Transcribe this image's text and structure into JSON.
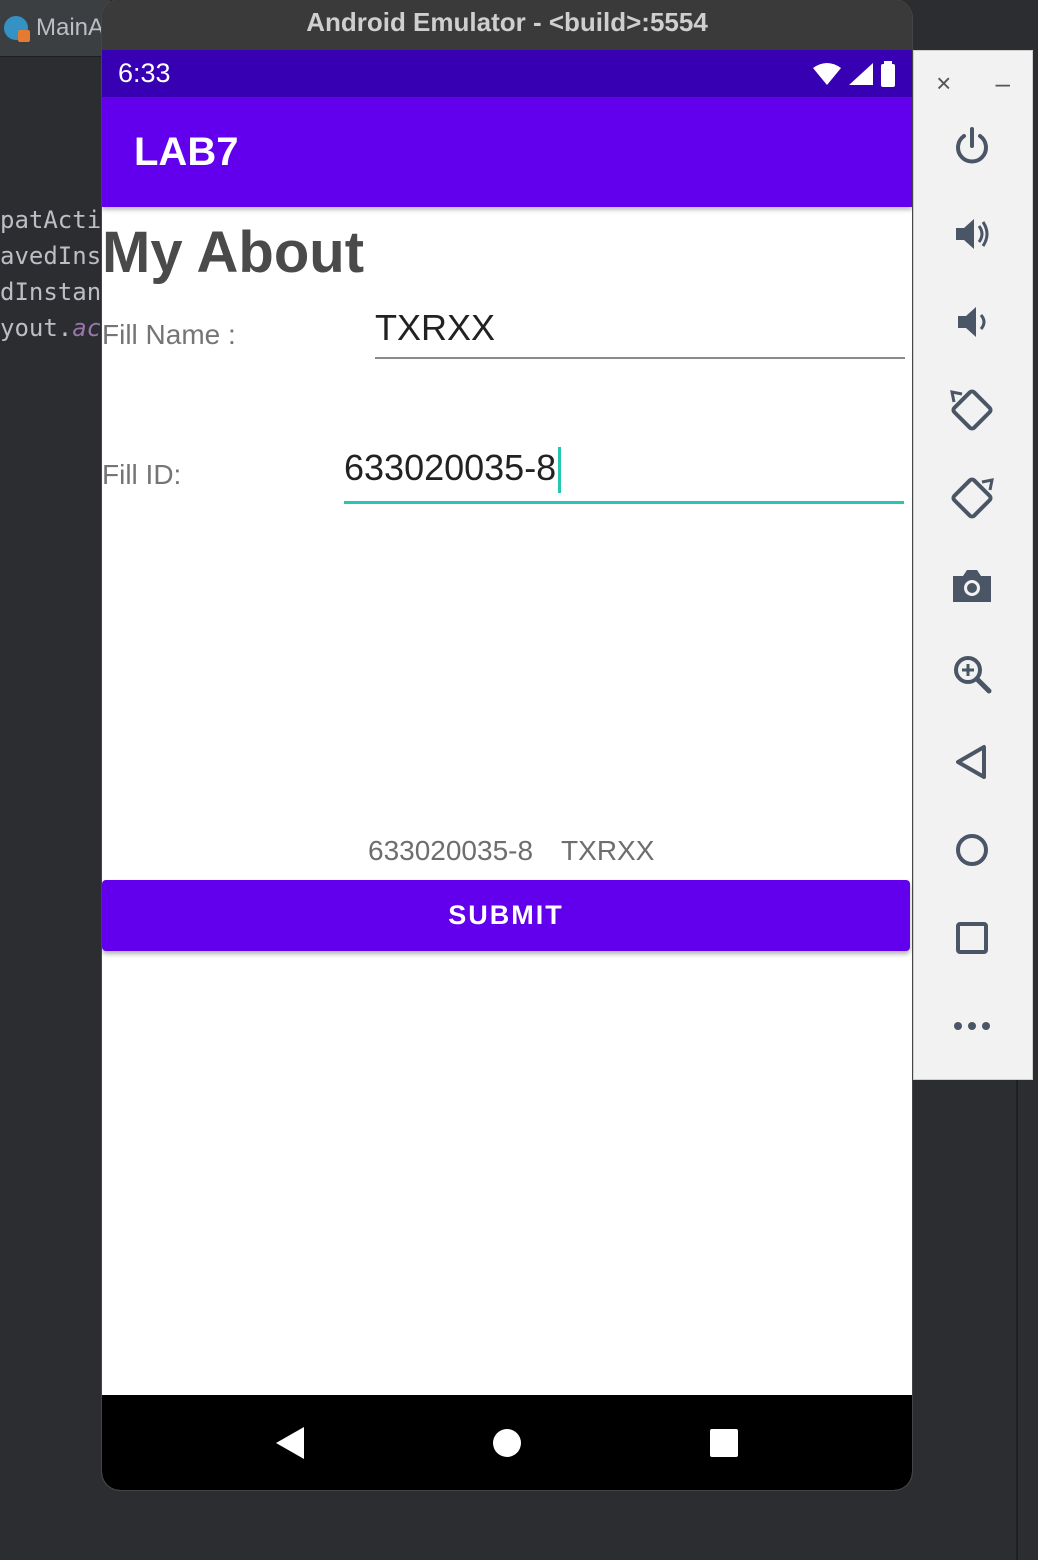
{
  "ide": {
    "tab_label": "MainA",
    "code_lines": [
      "patActiv",
      "avedInst",
      "dInstanc",
      "yout.",
      "act"
    ]
  },
  "emulator": {
    "title": "Android Emulator - <build>:5554"
  },
  "status_bar": {
    "time": "6:33"
  },
  "app_bar": {
    "title": "LAB7"
  },
  "screen": {
    "heading": "My About",
    "name_label": "Fill Name :",
    "name_value": "TXRXX",
    "id_label": "Fill ID:",
    "id_value": "633020035-8",
    "result_id": "633020035-8",
    "result_name": "TXRXX",
    "submit_label": "SUBMIT"
  },
  "toolbar": {
    "close_label": "×",
    "minimize_label": "–"
  },
  "colors": {
    "app_bar": "#6200ee",
    "status_bar": "#3700b3",
    "focus_accent": "#26c6b5"
  }
}
